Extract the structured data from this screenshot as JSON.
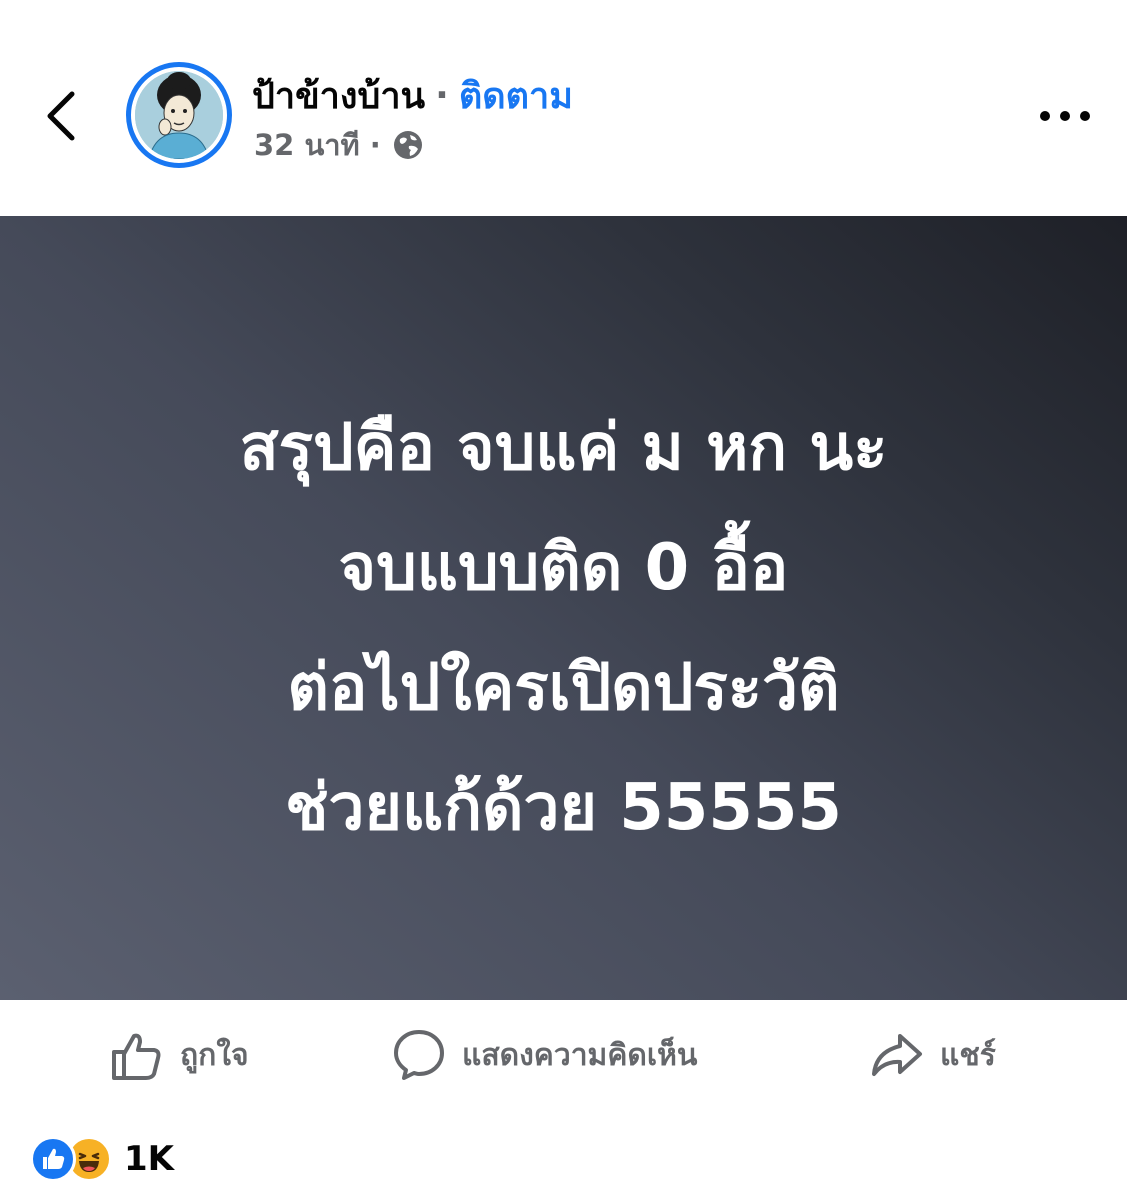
{
  "header": {
    "author_name": "ป้าข้างบ้าน",
    "separator": "·",
    "follow_label": "ติดตาม",
    "time": "32 นาที",
    "meta_separator": "·",
    "privacy_icon": "globe-icon",
    "back_icon": "chevron-left-icon",
    "more_icon": "more-horizontal-icon"
  },
  "post": {
    "lines": [
      "สรุปคือ จบแค่ ม หก นะ",
      "จบแบบติด 0 อื้อ",
      "ต่อไปใครเปิดประวัติ",
      "ช่วยแก้ด้วย 55555"
    ]
  },
  "actions": {
    "like_label": "ถูกใจ",
    "comment_label": "แสดงความคิดเห็น",
    "share_label": "แชร์"
  },
  "reactions": {
    "icons": [
      "like-reaction-icon",
      "haha-reaction-icon"
    ],
    "count": "1K"
  },
  "colors": {
    "accent": "#1877f2",
    "secondary_text": "#65676b",
    "post_bg_dark": "#1e2027",
    "post_bg_light": "#5b6070"
  }
}
